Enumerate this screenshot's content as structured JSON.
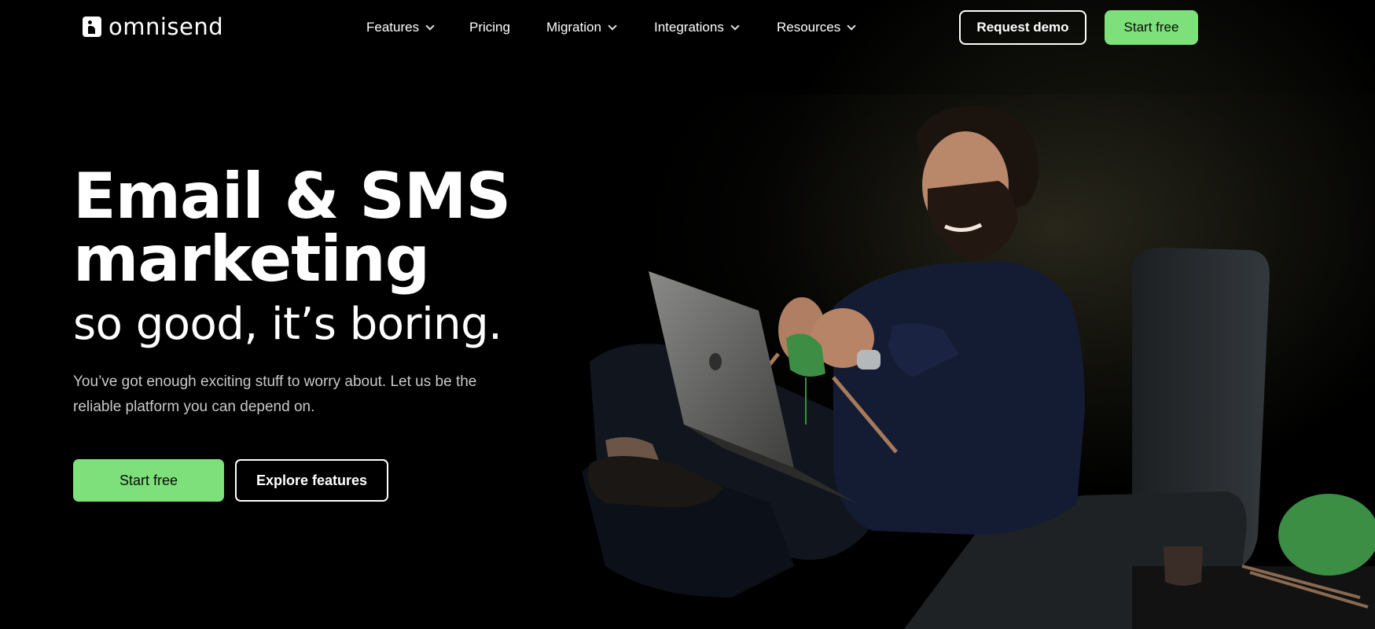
{
  "brand": {
    "name": "omnisend"
  },
  "nav": {
    "items": [
      {
        "label": "Features",
        "has_dropdown": true
      },
      {
        "label": "Pricing",
        "has_dropdown": false
      },
      {
        "label": "Migration",
        "has_dropdown": true
      },
      {
        "label": "Integrations",
        "has_dropdown": true
      },
      {
        "label": "Resources",
        "has_dropdown": true
      }
    ],
    "request_demo_label": "Request demo",
    "start_free_label": "Start free"
  },
  "hero": {
    "title_line1": "Email & SMS",
    "title_line2": "marketing",
    "subtitle": "so good, it’s boring.",
    "description": "You’ve got enough exciting stuff to worry about. Let us be the reliable platform you can depend on.",
    "primary_cta": "Start free",
    "secondary_cta": "Explore features"
  },
  "colors": {
    "accent_green": "#7ee07a",
    "background": "#000000",
    "text_primary": "#ffffff",
    "text_secondary": "#c9c9c9"
  },
  "icons": [
    "logo-icon",
    "chevron-down-icon"
  ]
}
